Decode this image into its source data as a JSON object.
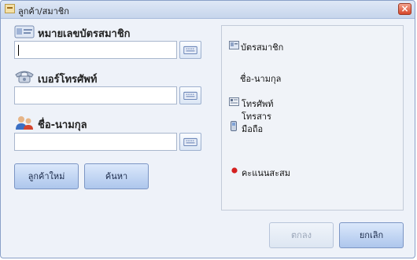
{
  "window": {
    "title": "ลูกค้า/สมาชิก",
    "close_glyph": "×"
  },
  "fields": {
    "member_card": {
      "label": "หมายเลขบัตรสมาชิก",
      "icon": "member-card-icon",
      "value": ""
    },
    "phone": {
      "label": "เบอร์โทรศัพท์",
      "icon": "telephone-icon",
      "value": ""
    },
    "name": {
      "label": "ชื่อ-นามกุล",
      "icon": "people-icon",
      "value": ""
    }
  },
  "buttons": {
    "new_customer": "ลูกค้าใหม่",
    "search": "ค้นหา",
    "ok": "ตกลง",
    "cancel": "ยกเลิก"
  },
  "info_panel": {
    "member_card": "บัตรสมาชิก",
    "full_name": "ชื่อ-นามกุล",
    "phone": "โทรศัพท์",
    "fax": "โทรสาร",
    "mobile": "มือถือ",
    "points": "คะแนนสะสม"
  },
  "colors": {
    "accent": "#adc6ec",
    "close": "#d6452a",
    "points_dot": "#d42020"
  }
}
